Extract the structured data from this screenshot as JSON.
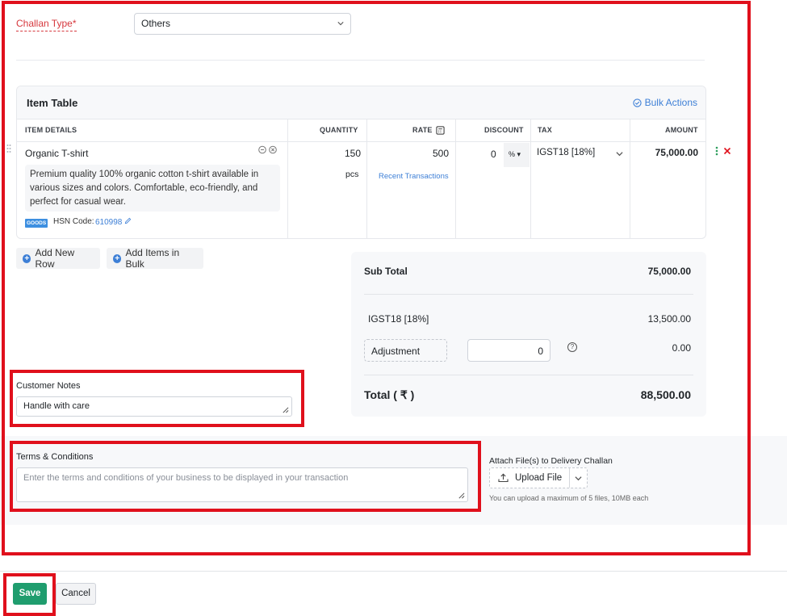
{
  "challan": {
    "label": "Challan Type*",
    "selected": "Others"
  },
  "item_table": {
    "title": "Item Table",
    "bulk_actions": "Bulk Actions",
    "columns": {
      "item_details": "ITEM DETAILS",
      "quantity": "QUANTITY",
      "rate": "RATE",
      "discount": "DISCOUNT",
      "tax": "TAX",
      "amount": "AMOUNT"
    },
    "row": {
      "name": "Organic T-shirt",
      "description": "Premium quality 100% organic cotton t-shirt available in various sizes and colors. Comfortable, eco-friendly, and perfect for casual wear.",
      "badge": "GOODS",
      "hsn_label": "HSN Code:",
      "hsn_value": "610998",
      "quantity": "150",
      "unit": "pcs",
      "rate": "500",
      "recent_transactions": "Recent Transactions",
      "discount": "0",
      "discount_unit": "%",
      "tax": "IGST18 [18%]",
      "amount": "75,000.00"
    }
  },
  "buttons": {
    "add_new_row": "Add New Row",
    "add_items_bulk": "Add Items in Bulk",
    "save": "Save",
    "cancel": "Cancel",
    "upload_file": "Upload File"
  },
  "totals": {
    "sub_total_label": "Sub Total",
    "sub_total_value": "75,000.00",
    "tax_label": "IGST18 [18%]",
    "tax_value": "13,500.00",
    "adjustment_label": "Adjustment",
    "adjustment_input": "0",
    "adjustment_value": "0.00",
    "total_label": "Total ( ₹ )",
    "total_value": "88,500.00"
  },
  "notes": {
    "label": "Customer Notes",
    "value": "Handle with care"
  },
  "terms": {
    "label": "Terms & Conditions",
    "placeholder": "Enter the terms and conditions of your business to be displayed in your transaction"
  },
  "attach": {
    "label": "Attach File(s) to Delivery Challan",
    "hint": "You can upload a maximum of 5 files, 10MB each"
  },
  "colors": {
    "annotation_red": "#e0101c",
    "primary_green": "#1f9d6e",
    "link_blue": "#3d7fd6",
    "required_red": "#d6383d"
  }
}
